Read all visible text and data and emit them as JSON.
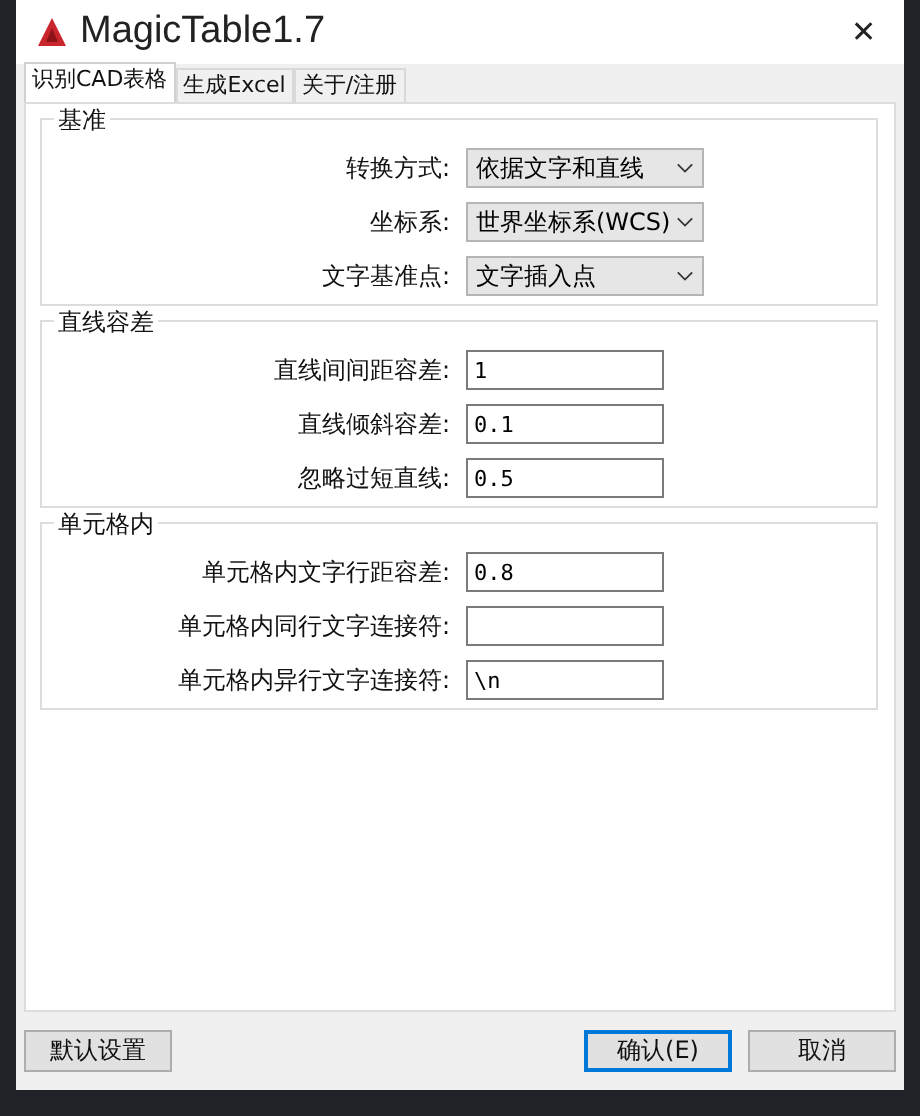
{
  "window": {
    "title": "MagicTable1.7",
    "close": "✕"
  },
  "tabs": [
    {
      "label": "识别CAD表格",
      "selected": true
    },
    {
      "label": "生成Excel",
      "selected": false
    },
    {
      "label": "关于/注册",
      "selected": false
    }
  ],
  "groups": [
    {
      "title": "基准",
      "fields": [
        {
          "kind": "dropdown",
          "label": "转换方式:",
          "value": "依据文字和直线"
        },
        {
          "kind": "dropdown",
          "label": "坐标系:",
          "value": "世界坐标系(WCS)"
        },
        {
          "kind": "dropdown",
          "label": "文字基准点:",
          "value": "文字插入点"
        }
      ]
    },
    {
      "title": "直线容差",
      "fields": [
        {
          "kind": "text",
          "label": "直线间间距容差:",
          "value": "1"
        },
        {
          "kind": "text",
          "label": "直线倾斜容差:",
          "value": "0.1"
        },
        {
          "kind": "text",
          "label": "忽略过短直线:",
          "value": "0.5"
        }
      ]
    },
    {
      "title": "单元格内",
      "fields": [
        {
          "kind": "text",
          "label": "单元格内文字行距容差:",
          "value": "0.8"
        },
        {
          "kind": "text",
          "label": "单元格内同行文字连接符:"
        },
        {
          "kind": "text",
          "label": "单元格内异行文字连接符:",
          "value": "\\n"
        }
      ]
    }
  ],
  "buttons": [
    {
      "label": "默认设置",
      "kind": "left",
      "focused": false
    },
    {
      "label": "确认(E)",
      "kind": "right",
      "focused": true
    },
    {
      "label": "取消",
      "kind": "right",
      "focused": false
    }
  ]
}
